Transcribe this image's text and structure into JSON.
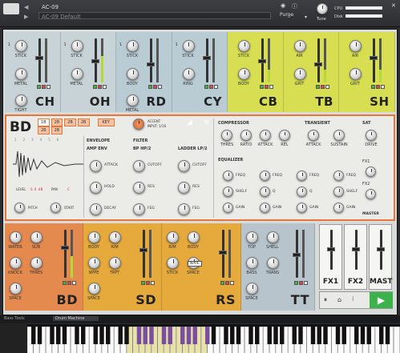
{
  "header": {
    "instrument_name": "AC-09",
    "preset_name": "AC-09 Default",
    "purge_label": "Purge",
    "tune_label": "Tune",
    "cpu_label": "CPU",
    "disk_label": "Disk",
    "icon_names": [
      "kontakt-logo-icon",
      "prev-icon",
      "next-icon",
      "camera-icon",
      "info-icon",
      "close-icon",
      "aux-icon"
    ]
  },
  "top_slots": [
    {
      "name": "CH",
      "knobs": [
        "STICK",
        "METAL",
        "TIGHT"
      ],
      "color": "#c7d3d6"
    },
    {
      "name": "OH",
      "knobs": [
        "STICK",
        "METAL"
      ],
      "color": "#c7d3d6"
    },
    {
      "name": "RD",
      "knobs": [
        "STICK",
        "BODY",
        "METAL"
      ],
      "color": "#b9ccd4"
    },
    {
      "name": "CY",
      "knobs": [
        "STICK",
        "RING"
      ],
      "color": "#b9ccd4"
    },
    {
      "name": "CB",
      "knobs": [
        "STICK",
        "BODY"
      ],
      "color": "#d7de52"
    },
    {
      "name": "TB",
      "knobs": [
        "AIR",
        "GRIT"
      ],
      "color": "#d7de52"
    },
    {
      "name": "SH",
      "knobs": [
        "AIR",
        "GRIT"
      ],
      "color": "#d7de52"
    }
  ],
  "bd_panel": {
    "name": "BD",
    "tabs": [
      "1B",
      "2B",
      "2B",
      "2B"
    ],
    "tab_row2": [
      "2B",
      "2B"
    ],
    "key_label": "KEY",
    "accent_label": "ACCENT",
    "input_label": "INPUT: 1/16",
    "step_numbers": [
      "1",
      "2",
      "3",
      "4",
      "5",
      "6"
    ],
    "level_label": "LEVEL",
    "pan_label": "PAN",
    "pitch_label": "PITCH",
    "start_label": "START",
    "level_val": "0.0 dB",
    "pan_val": "C",
    "envelope": {
      "title": "ENVELOPE",
      "sub": "AMP ENV",
      "knobs": [
        "ATTACK",
        "HOLD",
        "DECAY"
      ]
    },
    "filter": {
      "title": "FILTER",
      "sub": "BP HP/2",
      "knobs": [
        "CUTOFF",
        "RES",
        "FEG"
      ]
    },
    "ladder": {
      "sub": "LADDER LP/2",
      "knobs": [
        "CUTOFF",
        "RES",
        "FEG"
      ]
    },
    "compressor": {
      "title": "COMPRESSOR",
      "knobs": [
        "THRES",
        "RATIO",
        "ATTACK",
        "REL"
      ]
    },
    "transient": {
      "title": "TRANSIENT",
      "knobs": [
        "ATTACK",
        "SUSTAIN"
      ]
    },
    "sat": {
      "title": "SAT",
      "knobs": [
        "DRIVE"
      ]
    },
    "equalizer": {
      "title": "EQUALIZER",
      "knobs": [
        "FREQ",
        "FREQ",
        "FREQ",
        "FREQ",
        "SHELF",
        "Q",
        "Q",
        "SHELF",
        "GAIN",
        "GAIN",
        "GAIN",
        "GAIN"
      ]
    },
    "fx_label": "FX1",
    "fx2_label": "FX2",
    "master_label": "MASTER"
  },
  "bottom_slots": [
    {
      "name": "BD",
      "knobs": [
        "WATER",
        "SUB",
        "KNOCK",
        "THRES",
        "SPACE"
      ],
      "color": "#e58a4e"
    },
    {
      "name": "SD",
      "knobs": [
        "BODY",
        "RIM",
        "NPPE",
        "TRPT",
        "SPACE"
      ],
      "color": "#e6a93c"
    },
    {
      "name": "RS",
      "knobs": [
        "RIM",
        "BODY",
        "STICK",
        "SPACE"
      ],
      "button": "NPPE",
      "color": "#e6a93c"
    },
    {
      "name": "TT",
      "knobs": [
        "TOP",
        "SHELL",
        "BASS",
        "TRANS",
        "SPACE"
      ],
      "color": "#b8c4cc"
    }
  ],
  "fx_buses": [
    "FX1",
    "FX2",
    "MAST"
  ],
  "footer": {
    "tab1": "Bass Tools",
    "tab2": "Drum Machine"
  },
  "colors": {
    "orange": "#e8763a",
    "grey_blue": "#bdcdd3",
    "yellow": "#d9df50",
    "amber": "#e7a93a",
    "play_green": "#3bb34a"
  }
}
